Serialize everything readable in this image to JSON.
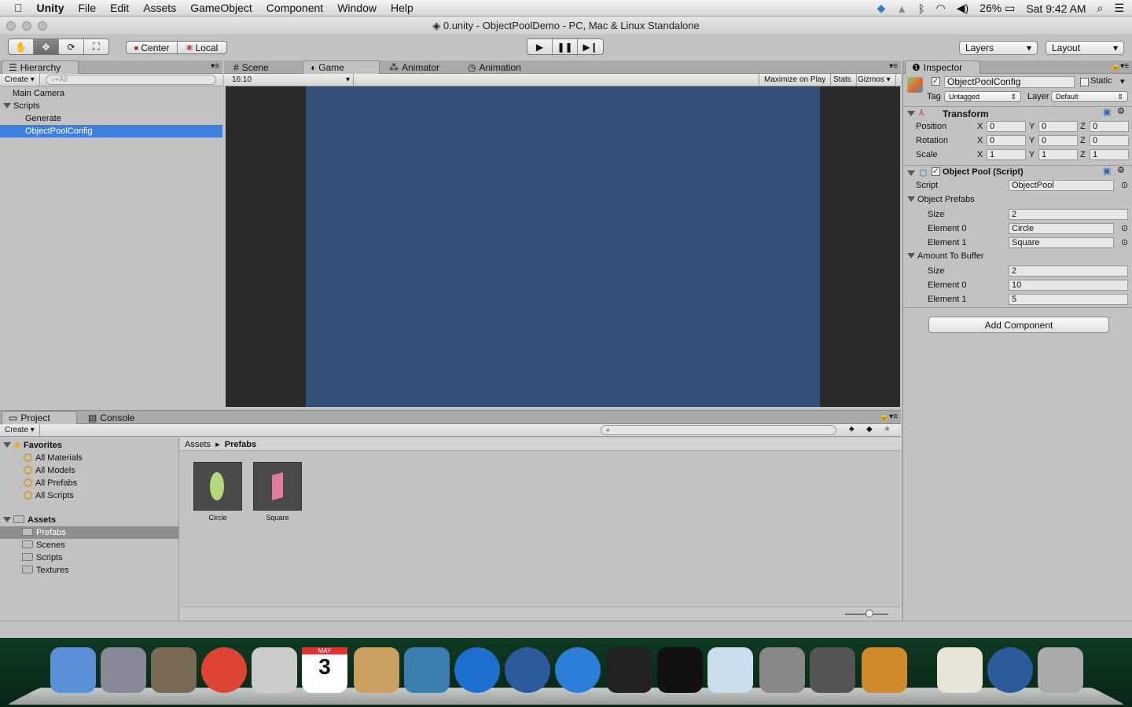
{
  "menubar": {
    "app": "Unity",
    "items": [
      "File",
      "Edit",
      "Assets",
      "GameObject",
      "Component",
      "Window",
      "Help"
    ],
    "battery": "26%",
    "clock": "Sat 9:42 AM"
  },
  "window": {
    "title": "0.unity - ObjectPoolDemo - PC, Mac & Linux Standalone"
  },
  "toolbar": {
    "pivot": "Center",
    "space": "Local",
    "layers": "Layers",
    "layout": "Layout"
  },
  "hierarchy": {
    "tab": "Hierarchy",
    "create": "Create",
    "search_placeholder": "All",
    "items": [
      {
        "label": "Main Camera",
        "depth": 0
      },
      {
        "label": "Scripts",
        "depth": 0,
        "expanded": true
      },
      {
        "label": "Generate",
        "depth": 1
      },
      {
        "label": "ObjectPoolConfig",
        "depth": 1,
        "selected": true
      }
    ]
  },
  "center": {
    "tabs": [
      "Scene",
      "Game",
      "Animator",
      "Animation"
    ],
    "active_tab": "Game",
    "aspect": "16:10",
    "maximize": "Maximize on Play",
    "stats": "Stats",
    "gizmos": "Gizmos",
    "bg_color": "#33507a"
  },
  "inspector": {
    "tab": "Inspector",
    "object_name": "ObjectPoolConfig",
    "active": true,
    "static_label": "Static",
    "tag_label": "Tag",
    "tag": "Untagged",
    "layer_label": "Layer",
    "layer": "Default",
    "transform": {
      "title": "Transform",
      "rows": [
        {
          "label": "Position",
          "x": "0",
          "y": "0",
          "z": "0"
        },
        {
          "label": "Rotation",
          "x": "0",
          "y": "0",
          "z": "0"
        },
        {
          "label": "Scale",
          "x": "1",
          "y": "1",
          "z": "1"
        }
      ]
    },
    "script": {
      "title": "Object Pool (Script)",
      "script_label": "Script",
      "script_value": "ObjectPool",
      "prefabs_label": "Object Prefabs",
      "prefabs": [
        {
          "label": "Size",
          "value": "2"
        },
        {
          "label": "Element 0",
          "value": "Circle"
        },
        {
          "label": "Element 1",
          "value": "Square"
        }
      ],
      "buffer_label": "Amount To Buffer",
      "buffer": [
        {
          "label": "Size",
          "value": "2"
        },
        {
          "label": "Element 0",
          "value": "10"
        },
        {
          "label": "Element 1",
          "value": "5"
        }
      ]
    },
    "add_component": "Add Component"
  },
  "project": {
    "tabs": [
      "Project",
      "Console"
    ],
    "create": "Create",
    "favorites_label": "Favorites",
    "favorites": [
      "All Materials",
      "All Models",
      "All Prefabs",
      "All Scripts"
    ],
    "assets_label": "Assets",
    "folders": [
      "Prefabs",
      "Scenes",
      "Scripts",
      "Textures"
    ],
    "selected_folder": "Prefabs",
    "breadcrumb": [
      "Assets",
      "Prefabs"
    ],
    "assets": [
      {
        "name": "Circle",
        "color": "#b5d97a"
      },
      {
        "name": "Square",
        "color": "#e07aa0"
      }
    ]
  },
  "dock": [
    "Finder",
    "Launchpad",
    "Image Capture",
    "Google Chrome",
    "Mail",
    "Calendar",
    "Contacts",
    "iPhoto",
    "iTunes",
    "1Password",
    "App Store",
    "Unity",
    "Terminal",
    "Preview",
    "System Preferences",
    "Sublime Text",
    "Pixelmator",
    "Home",
    "1Password",
    "Trash"
  ],
  "calendar": {
    "month": "MAY",
    "day": "3"
  }
}
